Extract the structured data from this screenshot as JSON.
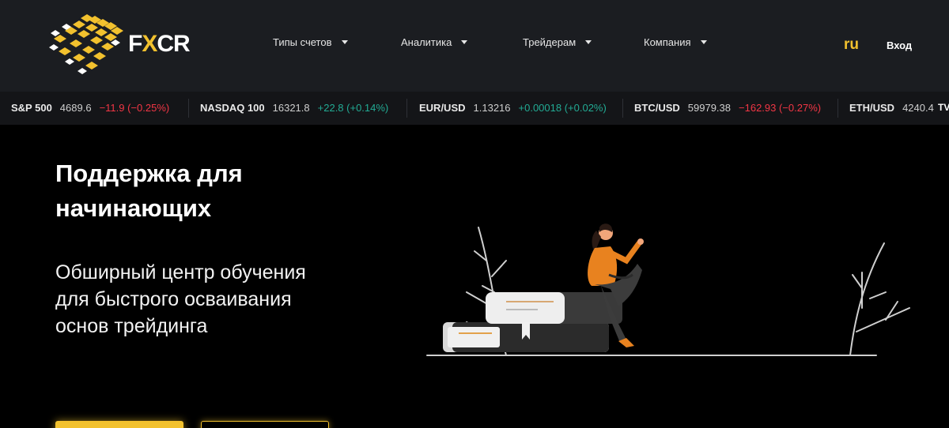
{
  "header": {
    "logo": {
      "text_prefix": "F",
      "text_x": "X",
      "text_suffix": "CR"
    },
    "nav": [
      {
        "label": "Типы счетов"
      },
      {
        "label": "Аналитика"
      },
      {
        "label": "Трейдерам"
      },
      {
        "label": "Компания"
      }
    ],
    "lang": "ru",
    "login": "Вход"
  },
  "ticker": [
    {
      "symbol": "S&P 500",
      "price": "4689.6",
      "change": "−11.9 (−0.25%)",
      "direction": "down"
    },
    {
      "symbol": "NASDAQ 100",
      "price": "16321.8",
      "change": "+22.8 (+0.14%)",
      "direction": "up"
    },
    {
      "symbol": "EUR/USD",
      "price": "1.13216",
      "change": "+0.00018 (+0.02%)",
      "direction": "up"
    },
    {
      "symbol": "BTC/USD",
      "price": "59979.38",
      "change": "−162.93 (−0.27%)",
      "direction": "down"
    },
    {
      "symbol": "ETH/USD",
      "price": "4240.4",
      "change": "",
      "direction": "up"
    }
  ],
  "ticker_brand": "TV",
  "hero": {
    "title": "Поддержка для начинающих",
    "subtitle": "Обширный центр обучения для быстрого осваивания основ трейдинга"
  },
  "colors": {
    "accent": "#f2c12e",
    "header_bg": "#1b1d21",
    "ticker_bg": "#141518",
    "up": "#22ab94",
    "down": "#f23645"
  },
  "icons": {
    "caret": "chevron-down-icon",
    "logo": "fxcr-logo-icon"
  }
}
